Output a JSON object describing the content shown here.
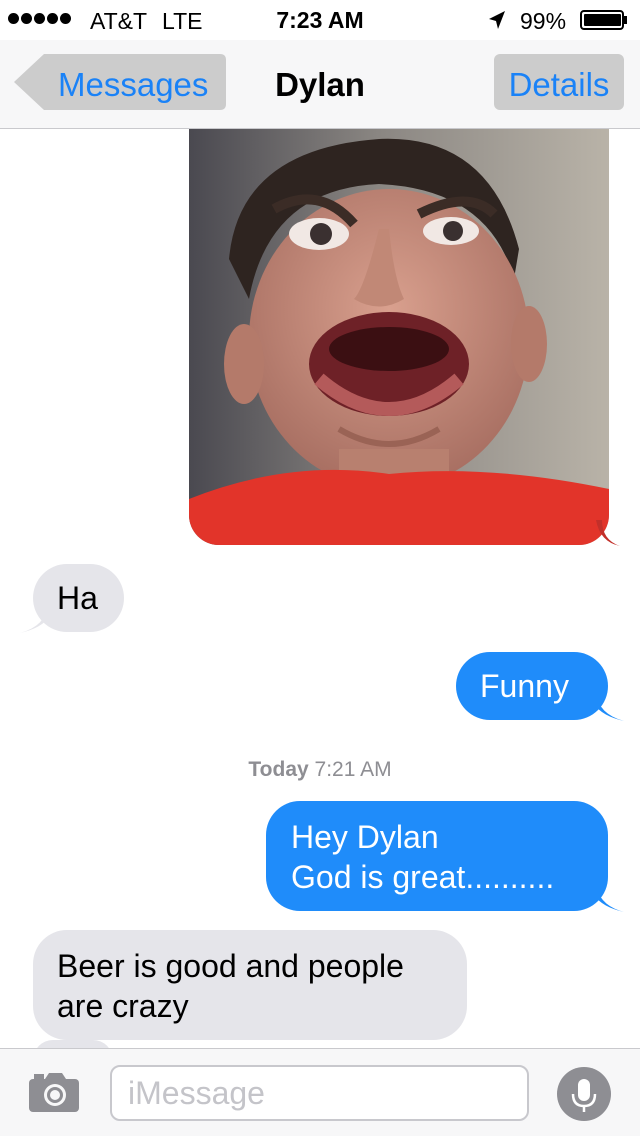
{
  "status_bar": {
    "carrier": "AT&T",
    "network": "LTE",
    "time": "7:23 AM",
    "battery": "99%",
    "battery_level": 0.99,
    "signal_bars": 5,
    "icons": [
      "signal-dots-icon",
      "location-arrow-icon",
      "battery-icon"
    ]
  },
  "nav": {
    "back_label": "Messages",
    "title": "Dylan",
    "details_label": "Details"
  },
  "conversation": {
    "photo": {
      "sender": "me",
      "icon": "photo-thumbnail"
    },
    "messages": [
      {
        "sender": "them",
        "text": "Ha"
      },
      {
        "sender": "me",
        "text": "Funny"
      },
      {
        "sender": "me",
        "lines": [
          "Hey Dylan",
          "God is great.........."
        ]
      },
      {
        "sender": "them",
        "lines": [
          "Beer is good and people",
          "are crazy"
        ]
      }
    ],
    "timestamp": {
      "day": "Today",
      "time": "7:21 AM"
    }
  },
  "input_bar": {
    "placeholder": "iMessage",
    "value": "",
    "icons": [
      "camera-icon",
      "microphone-icon"
    ]
  },
  "colors": {
    "ios_blue": "#1a82f7",
    "outgoing_bubble": "#1f8cfa",
    "incoming_bubble": "#e5e5ea",
    "bar_background": "#f7f7f8"
  }
}
